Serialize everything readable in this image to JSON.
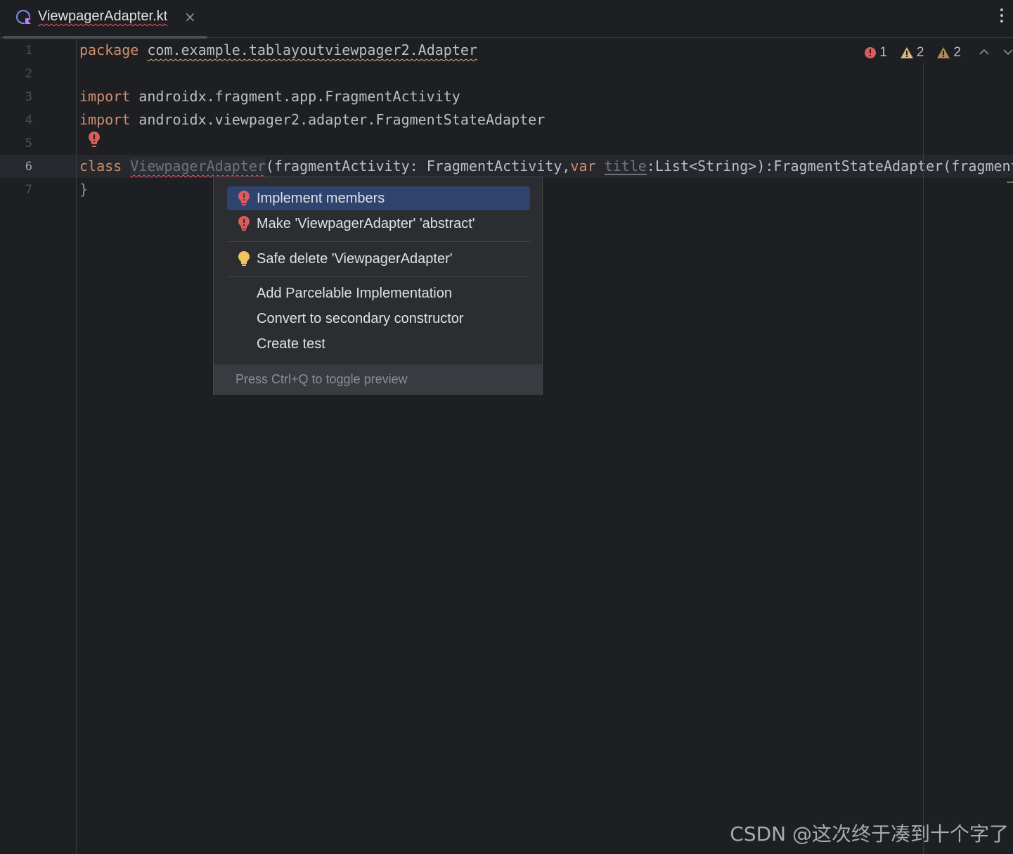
{
  "tab": {
    "title": "ViewpagerAdapter.kt",
    "close": "×"
  },
  "more_menu": "⋮",
  "inspections": {
    "errors": "1",
    "warnings": "2",
    "weak_warnings": "2",
    "up": "︿",
    "down": "﹀"
  },
  "lines": {
    "numbers": [
      "1",
      "2",
      "3",
      "4",
      "5",
      "6",
      "7"
    ],
    "l1_kw": "package",
    "l1_rest": "com.example.tablayoutviewpager2.Adapter",
    "l3_kw": "import",
    "l3_rest": " androidx.fragment.app.FragmentActivity",
    "l4_kw": "import",
    "l4_rest": " androidx.viewpager2.adapter.FragmentStateAdapter",
    "l6_kw": "class",
    "l6_name": "ViewpagerAdapter",
    "l6_a": "(fragmentActivity: FragmentActivity,",
    "l6_var": "var",
    "l6_title": "title",
    "l6_b": ":List<String>):FragmentStateAdapter(fragment",
    "l7": "}"
  },
  "popup": {
    "items": [
      {
        "label": "Implement members"
      },
      {
        "label": "Make 'ViewpagerAdapter' 'abstract'"
      },
      {
        "label": "Safe delete 'ViewpagerAdapter'"
      },
      {
        "label": "Add Parcelable Implementation"
      },
      {
        "label": "Convert to secondary constructor"
      },
      {
        "label": "Create test"
      }
    ],
    "footer": "Press Ctrl+Q to toggle preview"
  },
  "colors": {
    "error": "#db5c5c",
    "warning": "#d5b778",
    "selection": "#2e436e",
    "keyword": "#cf8e6d"
  },
  "watermark": "CSDN @这次终于凑到十个字了"
}
